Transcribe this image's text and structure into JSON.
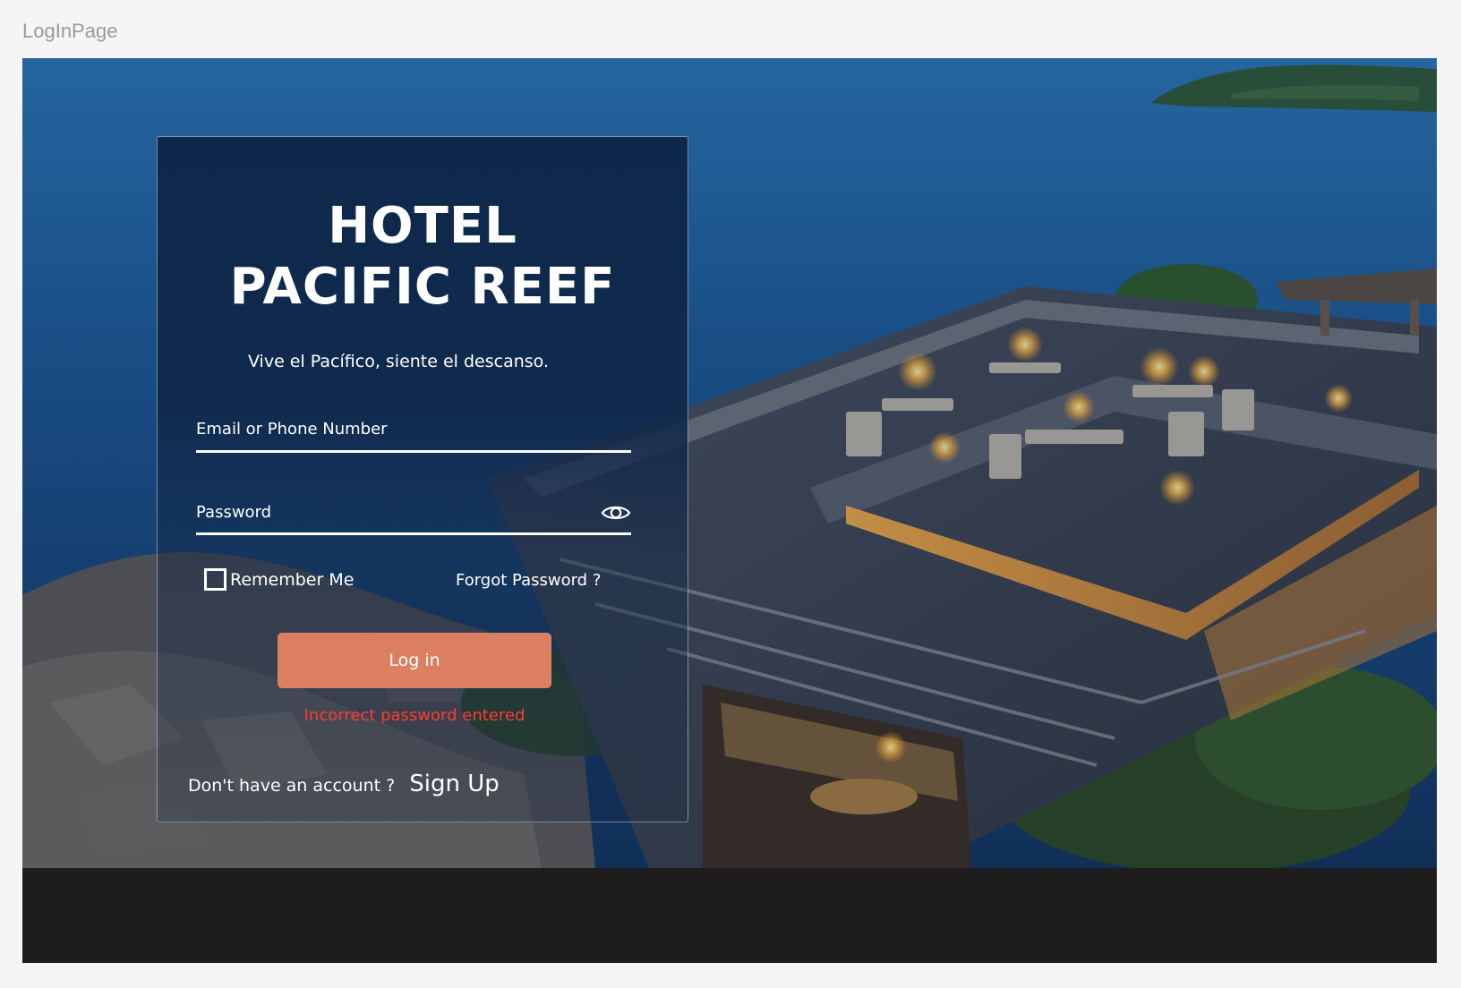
{
  "window": {
    "title": "LogInPage"
  },
  "hotel": {
    "name_line1": "HOTEL",
    "name_line2": "PACIFIC REEF",
    "tagline": "Vive el Pacífico, siente el descanso."
  },
  "form": {
    "email_placeholder": "Email or Phone Number",
    "password_placeholder": "Password",
    "remember_label": "Remember Me",
    "forgot_label": "Forgot Password ?",
    "login_label": "Log in",
    "error_text": "Incorrect password entered",
    "signup_prompt": "Don't have an account ?",
    "signup_label": "Sign Up"
  },
  "colors": {
    "accent_button": "#dc7f61",
    "error": "#ff3b2f",
    "panel": "#0f2a4e",
    "footer": "#1e1c1d"
  },
  "icons": {
    "password_toggle": "eye-icon",
    "remember_checkbox": "checkbox-unchecked"
  }
}
